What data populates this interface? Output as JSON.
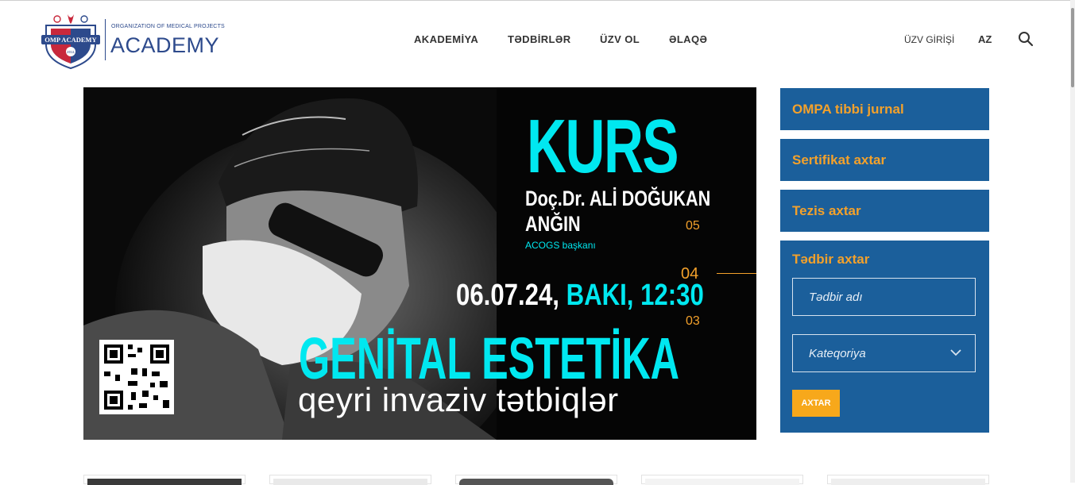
{
  "logo": {
    "seal_text": "OMP ACADEMY",
    "seal_year": "2011",
    "tagline": "ORGANIZATION OF MEDICAL PROJECTS",
    "name": "ACADEMY"
  },
  "nav": {
    "items": [
      "AKADEMİYA",
      "TƏDBİRLƏR",
      "ÜZV OL",
      "ƏLAQƏ"
    ],
    "member_login": "ÜZV GİRİŞİ",
    "language": "AZ"
  },
  "banner": {
    "headline": "KURS",
    "speaker_line1": "Doç.Dr. ALİ DOĞUKAN",
    "speaker_line2": "ANĞIN",
    "speaker_role": "ACOGS başkanı",
    "slide_numbers": [
      "05",
      "04",
      "03"
    ],
    "date_part": "06.07.24,",
    "place_time": " BAKI, 12:30",
    "topic": "GENİTAL ESTETİKA",
    "subtopic": "qeyri invaziv tətbiqlər"
  },
  "sidebar": {
    "links": [
      "OMPA tibbi jurnal",
      "Sertifikat axtar",
      "Tezis axtar"
    ],
    "event_search": {
      "title": "Tədbir axtar",
      "name_placeholder": "Tədbir adı",
      "category_placeholder": "Kateqoriya",
      "submit_label": "AXTAR"
    }
  },
  "colors": {
    "accent_blue": "#1b5f9b",
    "accent_orange": "#f3a12b",
    "banner_cyan": "#00e8f0"
  },
  "icons": {
    "search": "search-icon",
    "dropdown": "chevron-down-icon"
  }
}
